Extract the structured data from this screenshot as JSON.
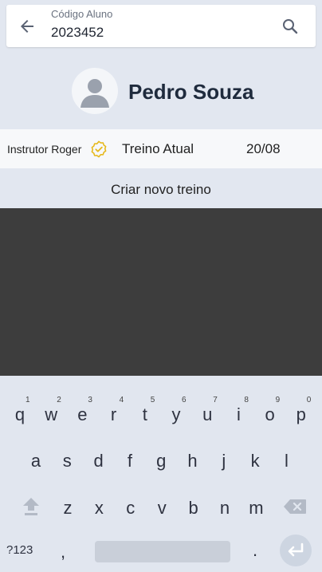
{
  "search": {
    "label": "Código Aluno",
    "value": "2023452"
  },
  "student": {
    "name": "Pedro Souza"
  },
  "workout": {
    "instructor": "Instrutor Roger",
    "label": "Treino Atual",
    "date": "20/08"
  },
  "create_workout_label": "Criar novo treino",
  "icons": {
    "back": "arrow-left-icon",
    "search": "search-icon",
    "avatar": "person-icon",
    "verified": "check-badge-icon",
    "shift": "shift-icon",
    "backspace": "backspace-icon",
    "enter": "enter-icon"
  },
  "colors": {
    "accent_badge": "#e6b81a",
    "header_bg": "#e2e7f0",
    "dark_area": "#3d3d3d"
  },
  "keyboard": {
    "row1": [
      {
        "key": "q",
        "hint": "1"
      },
      {
        "key": "w",
        "hint": "2"
      },
      {
        "key": "e",
        "hint": "3"
      },
      {
        "key": "r",
        "hint": "4"
      },
      {
        "key": "t",
        "hint": "5"
      },
      {
        "key": "y",
        "hint": "6"
      },
      {
        "key": "u",
        "hint": "7"
      },
      {
        "key": "i",
        "hint": "8"
      },
      {
        "key": "o",
        "hint": "9"
      },
      {
        "key": "p",
        "hint": "0"
      }
    ],
    "row2": [
      "a",
      "s",
      "d",
      "f",
      "g",
      "h",
      "j",
      "k",
      "l"
    ],
    "row3": [
      "z",
      "x",
      "c",
      "v",
      "b",
      "n",
      "m"
    ],
    "symbols_label": "?123",
    "comma": ",",
    "period": "."
  }
}
